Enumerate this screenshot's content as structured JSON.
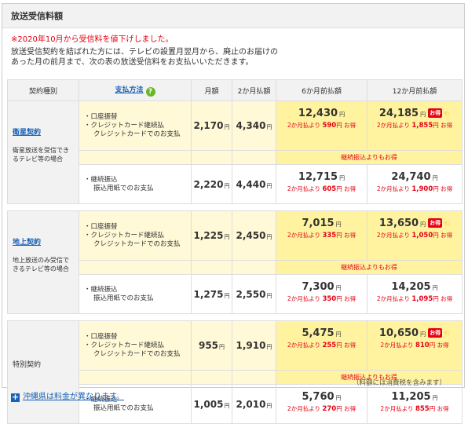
{
  "title": "放送受信料額",
  "notice": "※2020年10月から受信料を値下げしました。",
  "description": "放送受信契約を結ばれた方には、テレビの設置月翌月から、廃止のお届けのあった月の前月まで、次の表の放送受信料をお支払いいただきます。",
  "headers": {
    "type": "契約種別",
    "method": "支払方法",
    "help_icon": "?",
    "monthly": "月額",
    "two_month": "2か月払額",
    "six_month": "6か月前払額",
    "twelve_month": "12か月前払額"
  },
  "units": {
    "yen": "円",
    "otoku": "お得",
    "otoku_badge": "お得"
  },
  "methods": {
    "a1": "・口座振替",
    "a2": "・クレジットカード継続払",
    "a3": "クレジットカードでのお支払",
    "b1": "・継続振込",
    "b2": "振込用紙でのお支払"
  },
  "groups": [
    {
      "name": "衛星契約",
      "desc": "衛星放送を受信できるテレビ等の場合",
      "link": true,
      "a": {
        "monthly": "2,170",
        "two": "4,340",
        "six": "12,430",
        "six_prefix": "2か月払より",
        "six_save": "590",
        "twelve": "24,185",
        "twelve_prefix": "2か月払より",
        "twelve_save": "1,855"
      },
      "note": "継続振込よりもお得",
      "b": {
        "monthly": "2,220",
        "two": "4,440",
        "six": "12,715",
        "six_prefix": "2か月払より",
        "six_save": "605",
        "twelve": "24,740",
        "twelve_prefix": "2か月払より",
        "twelve_save": "1,900"
      }
    },
    {
      "name": "地上契約",
      "desc": "地上放送のみ受信できるテレビ等の場合",
      "link": true,
      "a": {
        "monthly": "1,225",
        "two": "2,450",
        "six": "7,015",
        "six_prefix": "2か月払より",
        "six_save": "335",
        "twelve": "13,650",
        "twelve_prefix": "2か月払より",
        "twelve_save": "1,050"
      },
      "note": "継続振込よりもお得",
      "b": {
        "monthly": "1,275",
        "two": "2,550",
        "six": "7,300",
        "six_prefix": "2か月払より",
        "six_save": "350",
        "twelve": "14,205",
        "twelve_prefix": "2か月払より",
        "twelve_save": "1,095"
      }
    },
    {
      "name": "特別契約",
      "desc": "",
      "link": false,
      "a": {
        "monthly": "955",
        "two": "1,910",
        "six": "5,475",
        "six_prefix": "2か月払より",
        "six_save": "255",
        "twelve": "10,650",
        "twelve_prefix": "2か月払より",
        "twelve_save": "810"
      },
      "note": "継続振込よりもお得",
      "b": {
        "monthly": "1,005",
        "two": "2,010",
        "six": "5,760",
        "six_prefix": "2か月払より",
        "six_save": "270",
        "twelve": "11,205",
        "twelve_prefix": "2か月払より",
        "twelve_save": "855"
      }
    }
  ],
  "tax_note": "（料額には消費税を含みます）",
  "okinawa": {
    "icon": "+",
    "label": "沖縄県は料金が異なります。"
  },
  "colors": {
    "accent_red": "#e60012",
    "link_blue": "#1a62b7",
    "highlight": "#fff3a0"
  }
}
